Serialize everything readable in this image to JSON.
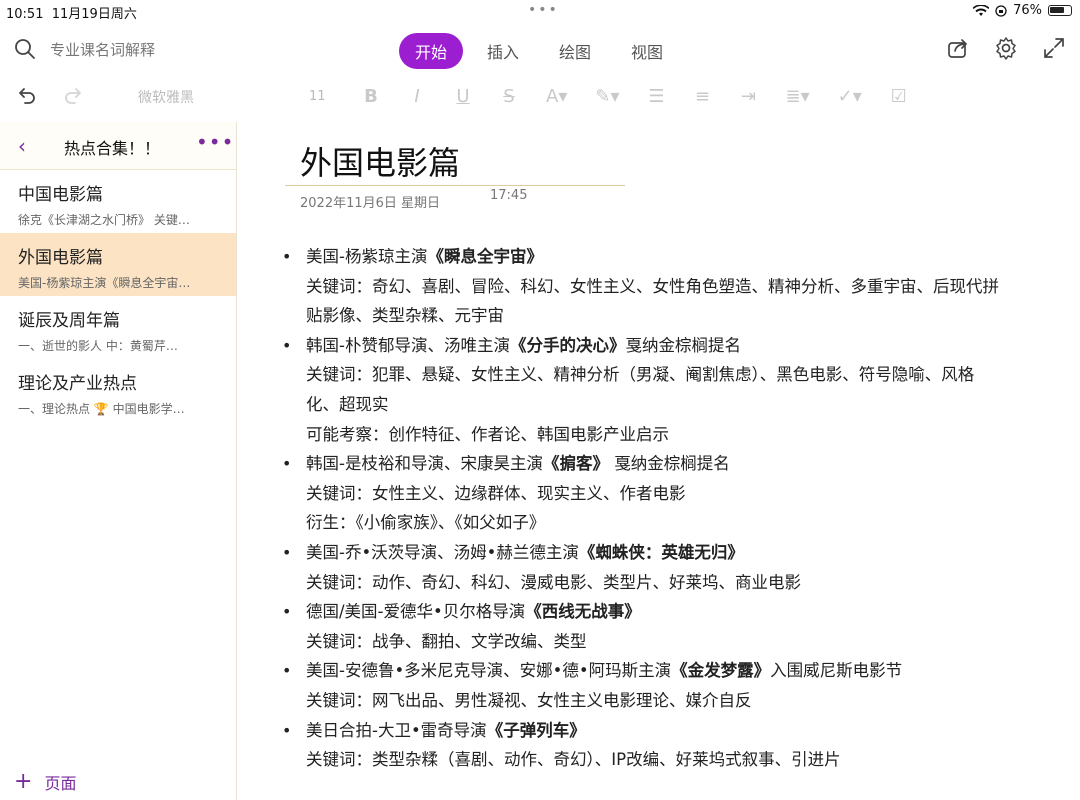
{
  "status": {
    "time": "10:51",
    "date": "11月19日周六",
    "battery": "76%"
  },
  "search": {
    "placeholder": "专业课名词解释"
  },
  "tabs": [
    {
      "label": "开始",
      "active": true
    },
    {
      "label": "插入"
    },
    {
      "label": "绘图"
    },
    {
      "label": "视图"
    }
  ],
  "format": {
    "font": "微软雅黑",
    "size": "11"
  },
  "sidebar": {
    "section_title": "热点合集！！",
    "pages": [
      {
        "title": "中国电影篇",
        "snippet": "徐克《长津湖之水门桥》 关键…"
      },
      {
        "title": "外国电影篇",
        "snippet": "美国-杨紫琼主演《瞬息全宇宙…"
      },
      {
        "title": "诞辰及周年篇",
        "snippet": "一、逝世的影人  中：黄蜀芹…"
      },
      {
        "title": "理论及产业热点",
        "snippet": "一、理论热点  🏆 中国电影学…"
      }
    ],
    "add_label": "页面"
  },
  "note": {
    "title": "外国电影篇",
    "date": "2022年11月6日 星期日",
    "time": "17:45",
    "items": [
      {
        "head_pre": "美国-杨紫琼主演",
        "head_bold": "《瞬息全宇宙》",
        "head_post": "",
        "lines": [
          "关键词：奇幻、喜剧、冒险、科幻、女性主义、女性角色塑造、精神分析、多重宇宙、后现代拼",
          "贴影像、类型杂糅、元宇宙"
        ]
      },
      {
        "head_pre": "韩国-朴赞郁导演、汤唯主演",
        "head_bold": "《分手的决心》",
        "head_post": "戛纳金棕榈提名",
        "lines": [
          "关键词：犯罪、悬疑、女性主义、精神分析（男凝、阉割焦虑）、黑色电影、符号隐喻、风格",
          "化、超现实",
          "可能考察：创作特征、作者论、韩国电影产业启示"
        ]
      },
      {
        "head_pre": "韩国-是枝裕和导演、宋康昊主演",
        "head_bold": "《掮客》",
        "head_post": " 戛纳金棕榈提名",
        "lines": [
          "关键词：女性主义、边缘群体、现实主义、作者电影",
          "衍生：《小偷家族》、《如父如子》"
        ]
      },
      {
        "head_pre": "美国-乔•沃茨导演、汤姆•赫兰德主演",
        "head_bold": "《蜘蛛侠：英雄无归》",
        "head_post": "",
        "lines": [
          "关键词：动作、奇幻、科幻、漫威电影、类型片、好莱坞、商业电影"
        ]
      },
      {
        "head_pre": "德国/美国-爱德华•贝尔格导演",
        "head_bold": "《西线无战事》",
        "head_post": "",
        "lines": [
          "关键词：战争、翻拍、文学改编、类型"
        ]
      },
      {
        "head_pre": "美国-安德鲁•多米尼克导演、安娜•德•阿玛斯主演",
        "head_bold": "《金发梦露》",
        "head_post": "入围威尼斯电影节",
        "lines": [
          "关键词：网飞出品、男性凝视、女性主义电影理论、媒介自反"
        ]
      },
      {
        "head_pre": "美日合拍-大卫•雷奇导演",
        "head_bold": "《子弹列车》",
        "head_post": "",
        "lines": [
          "关键词：类型杂糅（喜剧、动作、奇幻）、IP改编、好莱坞式叙事、引进片"
        ]
      }
    ]
  }
}
